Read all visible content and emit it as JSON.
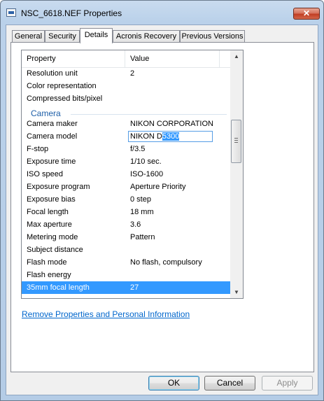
{
  "window": {
    "title": "NSC_6618.NEF Properties",
    "close_glyph": "✕"
  },
  "tabs": [
    {
      "label": "General"
    },
    {
      "label": "Security"
    },
    {
      "label": "Details"
    },
    {
      "label": "Acronis Recovery"
    },
    {
      "label": "Previous Versions"
    }
  ],
  "active_tab": "Details",
  "list": {
    "columns": {
      "property": "Property",
      "value": "Value"
    },
    "rows_top": [
      {
        "property": "Resolution unit",
        "value": "2"
      },
      {
        "property": "Color representation",
        "value": ""
      },
      {
        "property": "Compressed bits/pixel",
        "value": ""
      }
    ],
    "group": "Camera",
    "camera_maker": {
      "property": "Camera maker",
      "value": "NIKON CORPORATION"
    },
    "camera_model": {
      "property": "Camera model",
      "value_prefix": "NIKON D",
      "value_selected": "5300"
    },
    "rows_bottom": [
      {
        "property": "F-stop",
        "value": "f/3.5"
      },
      {
        "property": "Exposure time",
        "value": "1/10 sec."
      },
      {
        "property": "ISO speed",
        "value": "ISO-1600"
      },
      {
        "property": "Exposure program",
        "value": "Aperture Priority"
      },
      {
        "property": "Exposure bias",
        "value": "0 step"
      },
      {
        "property": "Focal length",
        "value": "18 mm"
      },
      {
        "property": "Max aperture",
        "value": "3.6"
      },
      {
        "property": "Metering mode",
        "value": "Pattern"
      },
      {
        "property": "Subject distance",
        "value": ""
      },
      {
        "property": "Flash mode",
        "value": "No flash, compulsory"
      },
      {
        "property": "Flash energy",
        "value": ""
      }
    ],
    "selected_row": {
      "property": "35mm focal length",
      "value": "27"
    },
    "scroll_up_glyph": "▲",
    "scroll_down_glyph": "▼"
  },
  "remove_link": "Remove Properties and Personal Information",
  "buttons": {
    "ok": "OK",
    "cancel": "Cancel",
    "apply": "Apply"
  },
  "colors": {
    "selection": "#3399ff",
    "group_header": "#1e5fa8",
    "link": "#0066cc"
  }
}
